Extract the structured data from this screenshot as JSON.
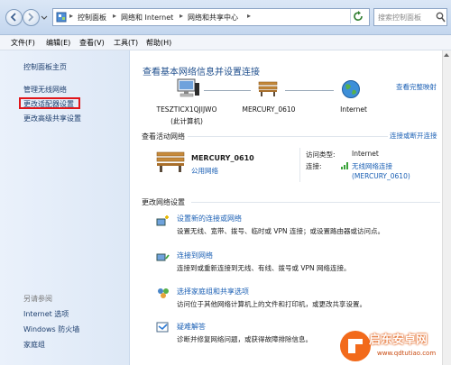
{
  "address": {
    "crumbs": [
      "控制面板",
      "网络和 Internet",
      "网络和共享中心"
    ],
    "search_placeholder": "搜索控制面板"
  },
  "menu": [
    "文件(F)",
    "编辑(E)",
    "查看(V)",
    "工具(T)",
    "帮助(H)"
  ],
  "sidebar": {
    "home": "控制面板主页",
    "items": [
      "管理无线网络",
      "更改适配器设置",
      "更改高级共享设置"
    ],
    "see_also": "另请参阅",
    "see_also_items": [
      "Internet 选项",
      "Windows 防火墙",
      "家庭组"
    ]
  },
  "main": {
    "title": "查看基本网络信息并设置连接",
    "full_map": "查看完整映射",
    "map": {
      "computer": "TESZTICX1QJIJWO",
      "computer_sub": "(此计算机)",
      "network": "MERCURY_0610",
      "internet": "Internet"
    },
    "active_header": "查看活动网络",
    "connect_link": "连接或断开连接",
    "active": {
      "name": "MERCURY_0610",
      "type": "公用网络",
      "access_label": "访问类型:",
      "access_value": "Internet",
      "conn_label": "连接:",
      "conn_value": "无线网络连接",
      "conn_value2": "(MERCURY_0610)"
    },
    "change_header": "更改网络设置",
    "tasks": [
      {
        "title": "设置新的连接或网络",
        "desc": "设置无线、宽带、拨号、临时或 VPN 连接；或设置路由器或访问点。"
      },
      {
        "title": "连接到网络",
        "desc": "连接到或重新连接到无线、有线、拨号或 VPN 网络连接。"
      },
      {
        "title": "选择家庭组和共享选项",
        "desc": "访问位于其他网络计算机上的文件和打印机，或更改共享设置。"
      },
      {
        "title": "疑难解答",
        "desc": "诊断并修复网络问题，或获得故障排除信息。"
      }
    ]
  },
  "watermark": {
    "title": "启东安卓网",
    "url": "www.qdtutiao.com"
  }
}
